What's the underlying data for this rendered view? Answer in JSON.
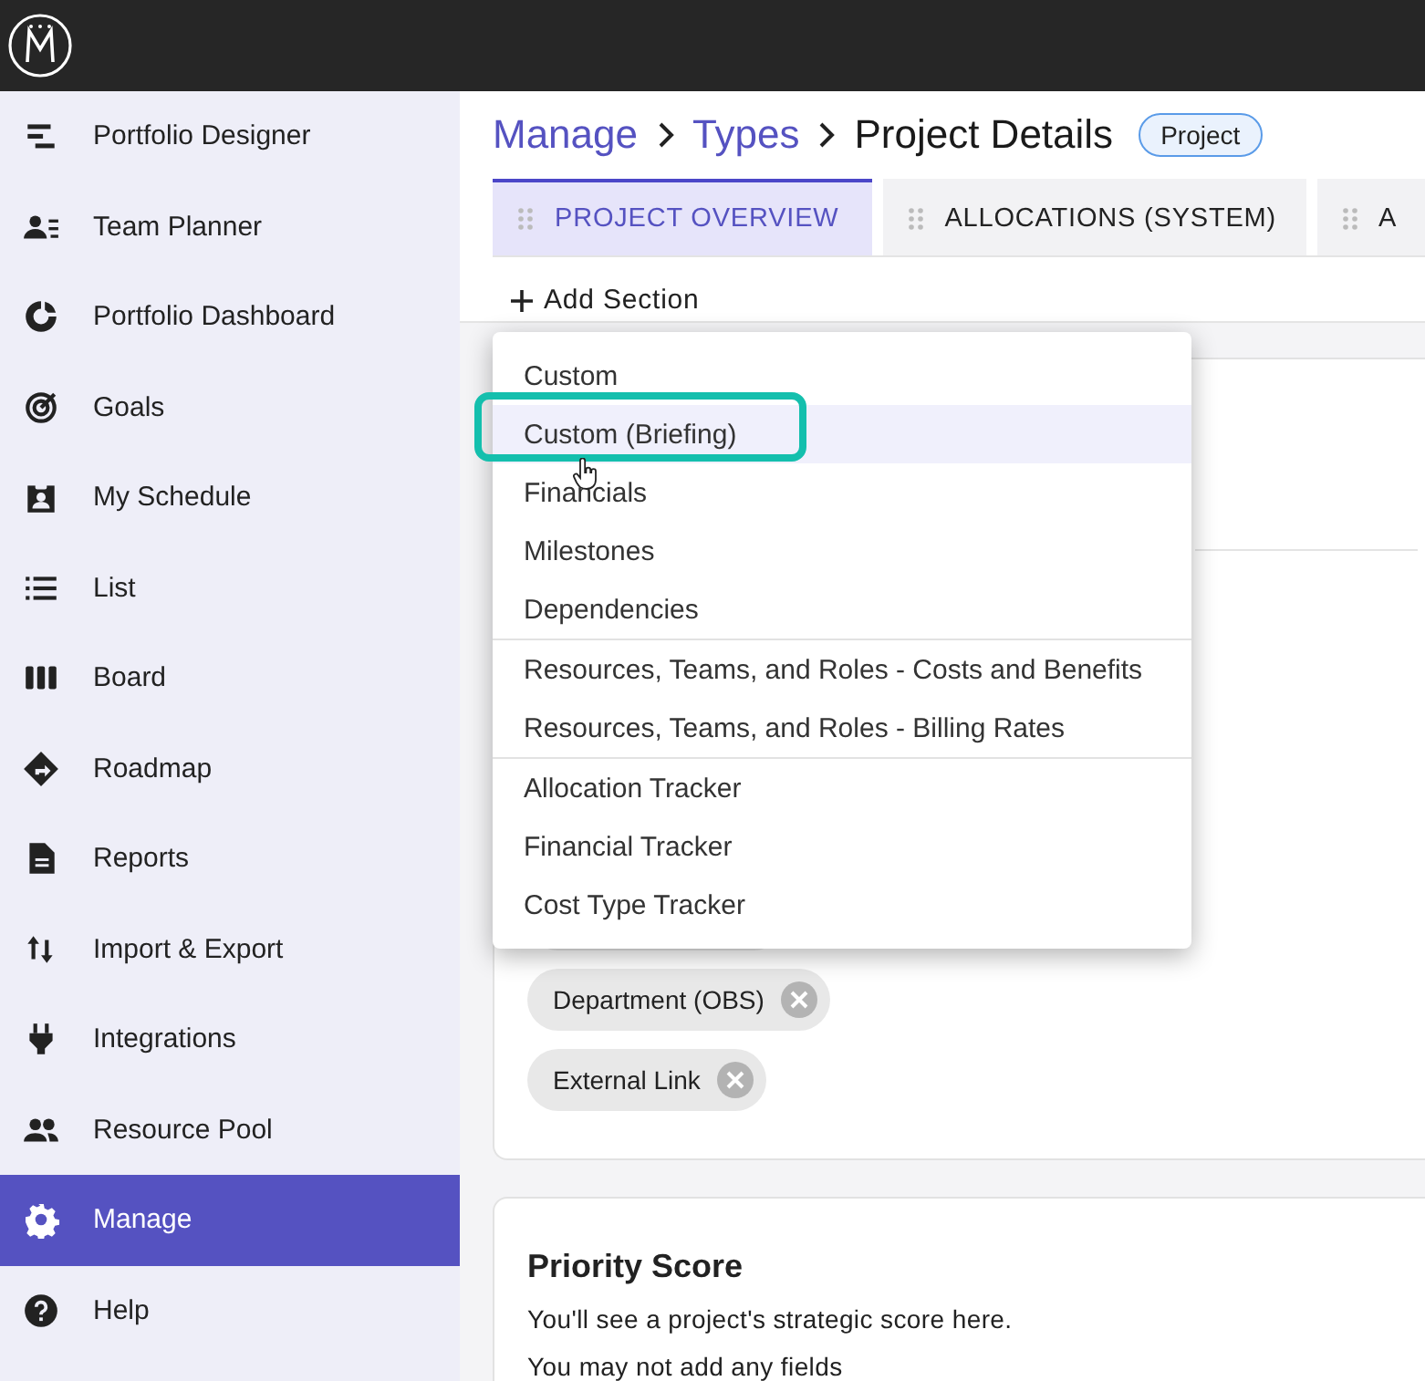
{
  "sidebar": {
    "items": [
      {
        "label": "Portfolio Designer",
        "selected": false
      },
      {
        "label": "Team Planner",
        "selected": false
      },
      {
        "label": "Portfolio Dashboard",
        "selected": false
      },
      {
        "label": "Goals",
        "selected": false
      },
      {
        "label": "My Schedule",
        "selected": false
      },
      {
        "label": "List",
        "selected": false
      },
      {
        "label": "Board",
        "selected": false
      },
      {
        "label": "Roadmap",
        "selected": false
      },
      {
        "label": "Reports",
        "selected": false
      },
      {
        "label": "Import & Export",
        "selected": false
      },
      {
        "label": "Integrations",
        "selected": false
      },
      {
        "label": "Resource Pool",
        "selected": false
      },
      {
        "label": "Manage",
        "selected": true
      },
      {
        "label": "Help",
        "selected": false
      }
    ]
  },
  "breadcrumb": [
    {
      "label": "Manage",
      "kind": "link"
    },
    {
      "label": "Types",
      "kind": "link"
    },
    {
      "label": "Project Details",
      "kind": "current"
    }
  ],
  "type_badge": "Project",
  "tabs": [
    {
      "label": "PROJECT OVERVIEW",
      "selected": true
    },
    {
      "label": "ALLOCATIONS (SYSTEM)",
      "selected": false
    },
    {
      "label": "A",
      "selected": false
    }
  ],
  "add_section": "Add Section",
  "section_menu": {
    "groups": [
      [
        {
          "label": "Custom",
          "selected": false
        },
        {
          "label": "Custom (Briefing)",
          "selected": true
        },
        {
          "label": "Financials",
          "selected": false
        },
        {
          "label": "Milestones",
          "selected": false
        },
        {
          "label": "Dependencies",
          "selected": false
        }
      ],
      [
        {
          "label": "Resources, Teams, and Roles - Costs and Benefits",
          "selected": false
        },
        {
          "label": "Resources, Teams, and Roles - Billing Rates",
          "selected": false
        }
      ],
      [
        {
          "label": "Allocation Tracker",
          "selected": false
        },
        {
          "label": "Financial Tracker",
          "selected": false
        },
        {
          "label": "Cost Type Tracker",
          "selected": false
        }
      ]
    ]
  },
  "fields_card": {
    "chips": [
      {
        "label": "Department (OBS)"
      },
      {
        "label": "External Link"
      }
    ]
  },
  "priority_card": {
    "title": "Priority Score",
    "lines": [
      "You'll see a project's strategic score here.",
      "You may not add any fields"
    ]
  }
}
